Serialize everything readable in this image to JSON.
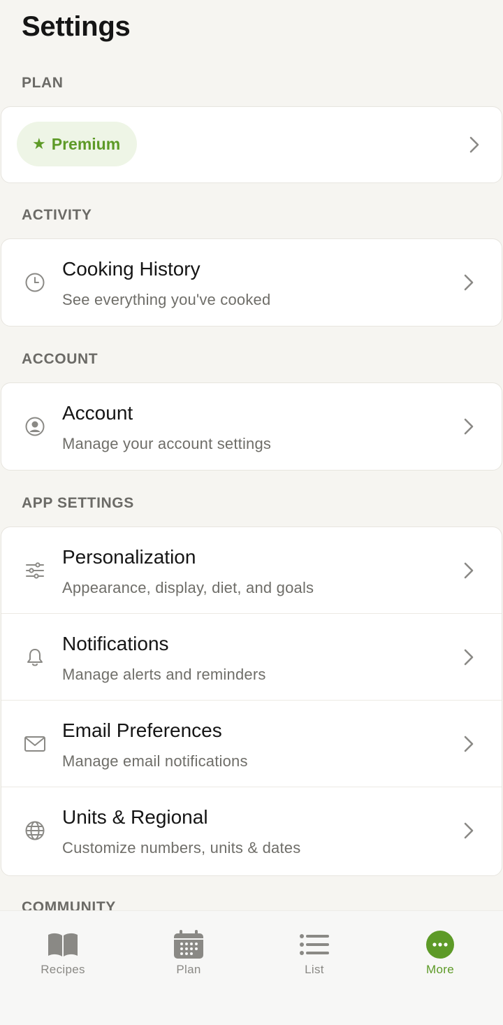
{
  "header": {
    "title": "Settings"
  },
  "sections": {
    "plan": {
      "label": "PLAN",
      "premium_label": "Premium"
    },
    "activity": {
      "label": "ACTIVITY",
      "items": [
        {
          "title": "Cooking History",
          "subtitle": "See everything you've cooked",
          "icon": "clock-icon"
        }
      ]
    },
    "account": {
      "label": "ACCOUNT",
      "items": [
        {
          "title": "Account",
          "subtitle": "Manage your account settings",
          "icon": "user-circle-icon"
        }
      ]
    },
    "app_settings": {
      "label": "APP SETTINGS",
      "items": [
        {
          "title": "Personalization",
          "subtitle": "Appearance, display, diet, and goals",
          "icon": "sliders-icon"
        },
        {
          "title": "Notifications",
          "subtitle": "Manage alerts and reminders",
          "icon": "bell-icon"
        },
        {
          "title": "Email Preferences",
          "subtitle": "Manage email notifications",
          "icon": "envelope-icon"
        },
        {
          "title": "Units & Regional",
          "subtitle": "Customize numbers, units & dates",
          "icon": "globe-icon"
        }
      ]
    },
    "community": {
      "label": "COMMUNITY"
    }
  },
  "tabbar": {
    "items": [
      {
        "label": "Recipes",
        "icon": "book-icon",
        "active": false
      },
      {
        "label": "Plan",
        "icon": "calendar-icon",
        "active": false
      },
      {
        "label": "List",
        "icon": "list-icon",
        "active": false
      },
      {
        "label": "More",
        "icon": "more-icon",
        "active": true
      }
    ]
  },
  "colors": {
    "accent": "#5d9a27",
    "background": "#f6f5f1",
    "card": "#ffffff",
    "icon_gray": "#8a8985",
    "premium_pill": "#eef5e6"
  }
}
